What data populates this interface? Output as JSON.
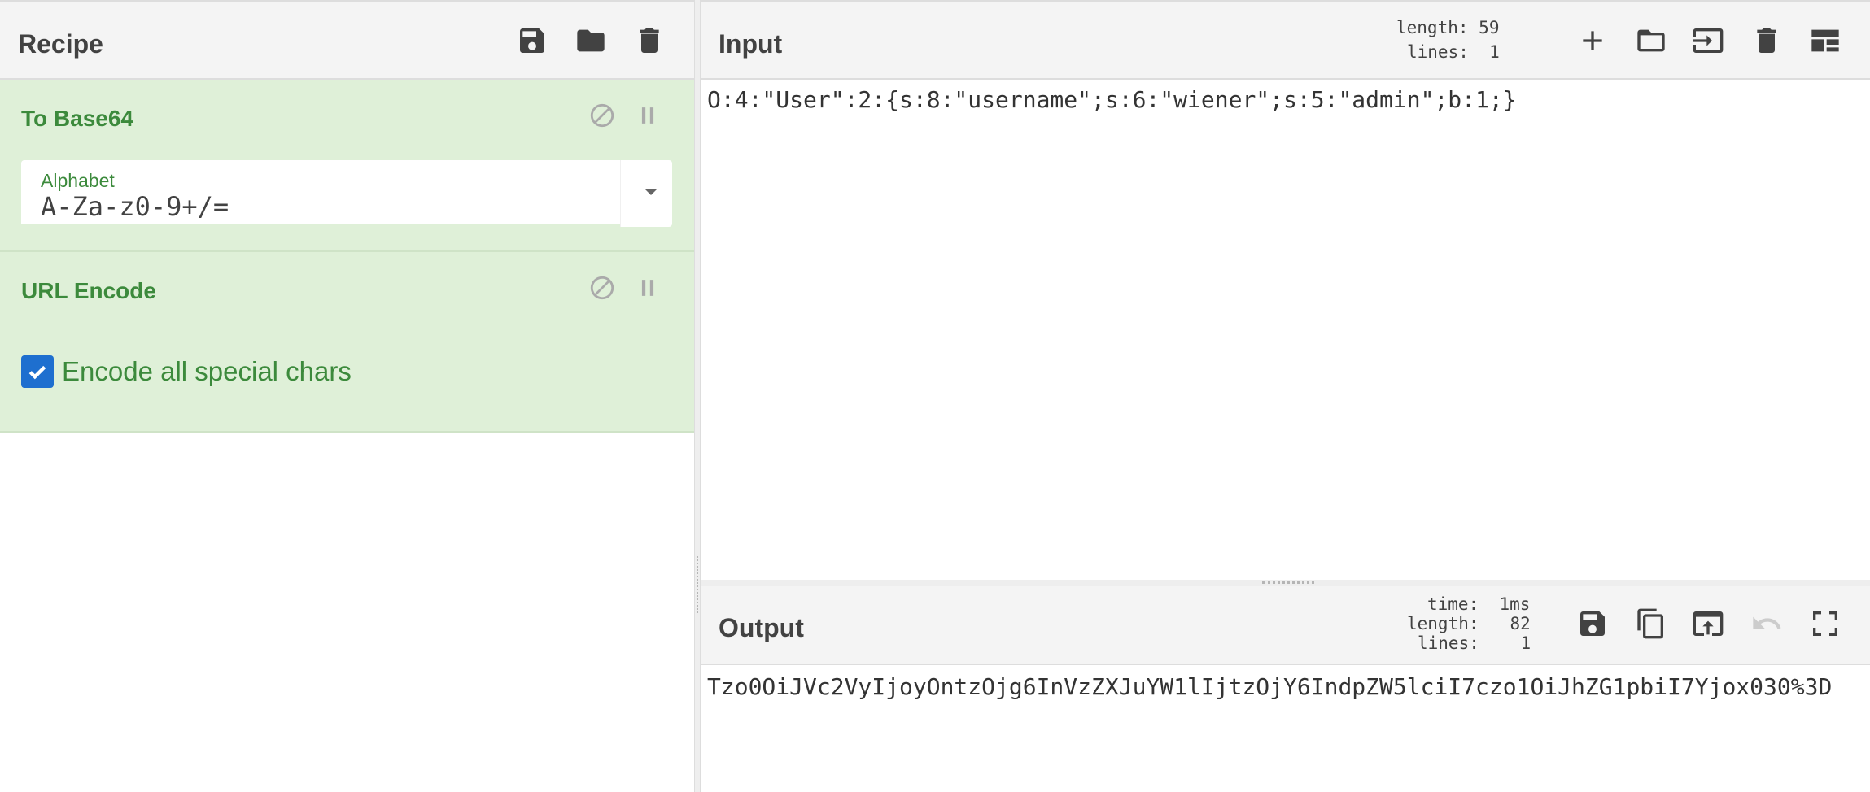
{
  "recipe": {
    "title": "Recipe",
    "icons": [
      "save-icon",
      "folder-icon",
      "trash-icon"
    ],
    "operations": [
      {
        "name": "To Base64",
        "alphabet_label": "Alphabet",
        "alphabet_value": "A-Za-z0-9+/="
      },
      {
        "name": "URL Encode",
        "checkbox_label": "Encode all special chars",
        "checkbox_checked": true
      }
    ]
  },
  "input": {
    "title": "Input",
    "stats": {
      "length_label": "length:",
      "length_value": "59",
      "lines_label": "lines:",
      "lines_value": "1"
    },
    "text": "O:4:\"User\":2:{s:8:\"username\";s:6:\"wiener\";s:5:\"admin\";b:1;}",
    "icons": [
      "plus-icon",
      "open-folder-icon",
      "input-arrow-icon",
      "trash-icon",
      "layout-icon"
    ]
  },
  "output": {
    "title": "Output",
    "stats": {
      "time_label": "time:",
      "time_value": "1ms",
      "length_label": "length:",
      "length_value": "82",
      "lines_label": "lines:",
      "lines_value": "1"
    },
    "text": "Tzo0OiJVc2VyIjoyOntzOjg6InVzZXJuYW1lIjtzOjY6IndpZW5lciI7czo1OiJhZG1pbiI7Yjox030%3D",
    "icons": [
      "save-icon",
      "copy-icon",
      "replace-input-icon",
      "undo-icon",
      "maximize-icon"
    ]
  },
  "colors": {
    "accent_green": "#3c8a3c",
    "op_background": "#dff0d8",
    "checkbox_blue": "#1e6fcf"
  }
}
